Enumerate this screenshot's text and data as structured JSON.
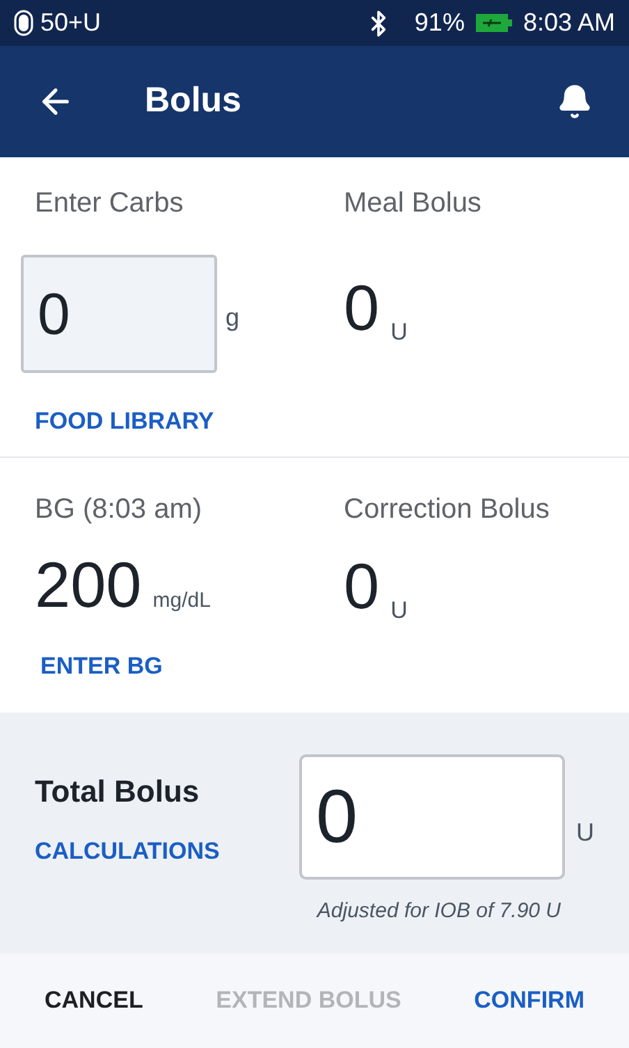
{
  "status_bar": {
    "pod": "50+U",
    "battery": "91%",
    "time": "8:03 AM"
  },
  "header": {
    "title": "Bolus"
  },
  "carbs": {
    "label": "Enter Carbs",
    "value": "0",
    "unit": "g",
    "link": "FOOD LIBRARY"
  },
  "meal_bolus": {
    "label": "Meal Bolus",
    "value": "0",
    "unit": "U"
  },
  "bg": {
    "label": "BG (8:03 am)",
    "value": "200",
    "unit": "mg/dL",
    "link": "ENTER BG"
  },
  "correction_bolus": {
    "label": "Correction Bolus",
    "value": "0",
    "unit": "U"
  },
  "total": {
    "label": "Total Bolus",
    "link": "CALCULATIONS",
    "value": "0",
    "unit": "U",
    "note": "Adjusted for IOB of 7.90 U"
  },
  "actions": [
    {
      "label": "CANCEL",
      "kind": "dismiss",
      "disabled": false
    },
    {
      "label": "EXTEND BOLUS",
      "kind": "secondary",
      "disabled": true
    },
    {
      "label": "CONFIRM",
      "kind": "primary",
      "disabled": false
    }
  ]
}
